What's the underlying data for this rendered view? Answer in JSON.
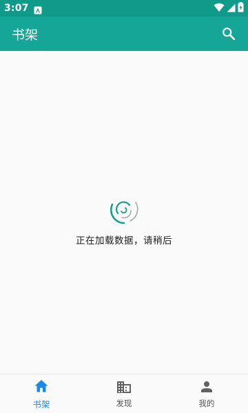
{
  "status_bar": {
    "time": "3:07",
    "notification_icon": "android-notification-icon",
    "wifi_icon": "wifi-icon",
    "signal_icon": "cell-signal-icon",
    "battery_icon": "battery-charging-icon"
  },
  "app_bar": {
    "title": "书架",
    "search_icon": "search-icon"
  },
  "loading": {
    "message": "正在加载数据，请稍后",
    "spinner_icon": "loading-spinner-icon"
  },
  "bottom_nav": {
    "items": [
      {
        "label": "书架",
        "icon": "home-icon",
        "active": true
      },
      {
        "label": "发现",
        "icon": "building-icon",
        "active": false
      },
      {
        "label": "我的",
        "icon": "person-icon",
        "active": false
      }
    ]
  },
  "colors": {
    "primary": "#15a697",
    "primary_dark": "#0f9a8a",
    "active_tab": "#1e88e5",
    "inactive_tab": "#555555",
    "spinner": "#1a9c8e"
  }
}
